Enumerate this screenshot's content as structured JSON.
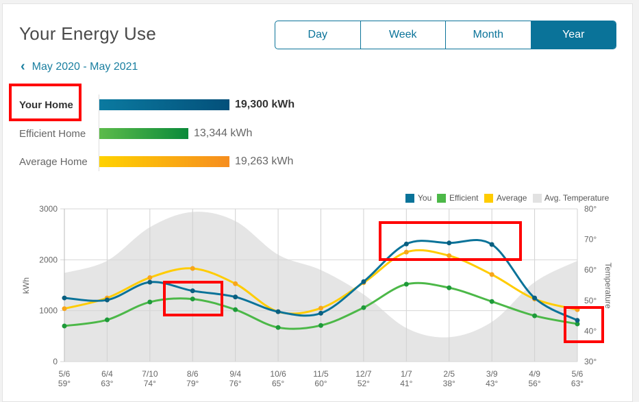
{
  "header": {
    "title": "Your Energy Use",
    "tabs": [
      {
        "label": "Day"
      },
      {
        "label": "Week"
      },
      {
        "label": "Month"
      },
      {
        "label": "Year",
        "active": true
      }
    ],
    "date_range": "May 2020 - May 2021",
    "back_icon": "chevron-left-icon"
  },
  "summary": [
    {
      "label": "Your Home",
      "value": "19,300 kWh",
      "kwh": 19300,
      "colors": [
        "#0b7aa0",
        "#03507a"
      ]
    },
    {
      "label": "Efficient Home",
      "value": "13,344 kWh",
      "kwh": 13344,
      "colors": [
        "#5cbb4a",
        "#0a8a3a"
      ]
    },
    {
      "label": "Average Home",
      "value": "19,263 kWh",
      "kwh": 19263,
      "colors": [
        "#ffd200",
        "#f68d1f"
      ]
    }
  ],
  "colors": {
    "accent": "#0a7399",
    "you": "#0a7399",
    "efficient": "#4cb848",
    "average": "#ffcc00",
    "temperature": "#e2e2e2",
    "highlight": "#ff0000"
  },
  "chart_data": {
    "type": "line",
    "categories": [
      "5/6",
      "6/4",
      "7/10",
      "8/6",
      "9/4",
      "10/6",
      "11/5",
      "12/7",
      "1/7",
      "2/5",
      "3/9",
      "4/9",
      "5/6"
    ],
    "temperature_labels": [
      "59°",
      "63°",
      "74°",
      "79°",
      "76°",
      "65°",
      "60°",
      "52°",
      "41°",
      "38°",
      "43°",
      "56°",
      "63°"
    ],
    "ylabel": "kWh",
    "y2label": "Temperature",
    "ylim": [
      0,
      3000
    ],
    "yticks": [
      "0",
      "1000",
      "2000",
      "3000"
    ],
    "y2lim": [
      30,
      80
    ],
    "y2ticks": [
      "30°",
      "40°",
      "50°",
      "60°",
      "70°",
      "80°"
    ],
    "legend_position": "top-right",
    "grid": true,
    "series": [
      {
        "name": "You",
        "values": [
          1250,
          1210,
          1560,
          1390,
          1270,
          980,
          950,
          1570,
          2310,
          2330,
          2300,
          1250,
          810
        ]
      },
      {
        "name": "Efficient",
        "values": [
          700,
          820,
          1170,
          1230,
          1020,
          670,
          710,
          1060,
          1520,
          1450,
          1180,
          900,
          740
        ]
      },
      {
        "name": "Average",
        "values": [
          1040,
          1250,
          1650,
          1830,
          1530,
          980,
          1050,
          1550,
          2150,
          2080,
          1710,
          1230,
          1020
        ]
      },
      {
        "name": "Avg. Temperature",
        "values": [
          59,
          63,
          74,
          79,
          76,
          65,
          60,
          52,
          41,
          38,
          43,
          56,
          63
        ],
        "type": "area"
      }
    ]
  }
}
